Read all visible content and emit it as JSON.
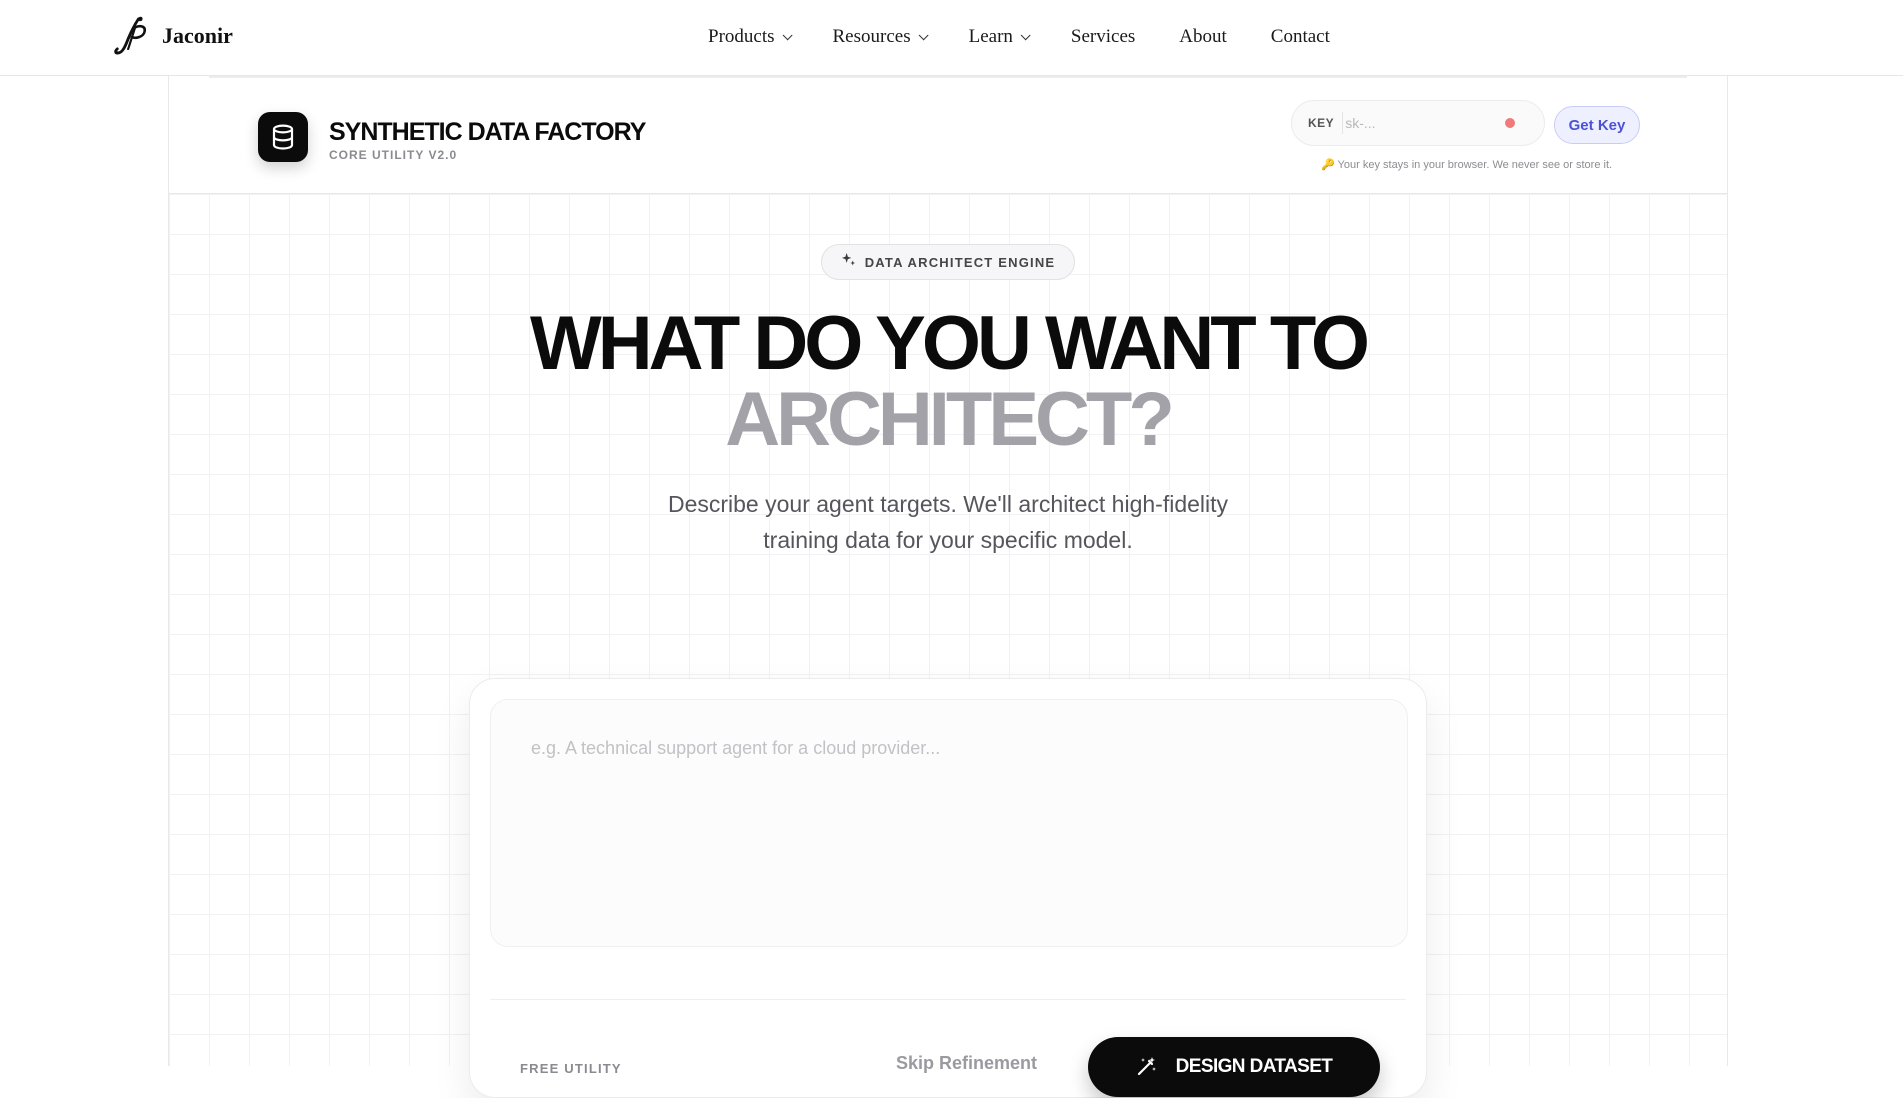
{
  "site": {
    "brand_name": "Jaconir",
    "nav": [
      {
        "label": "Products",
        "dropdown": true
      },
      {
        "label": "Resources",
        "dropdown": true
      },
      {
        "label": "Learn",
        "dropdown": true
      },
      {
        "label": "Services",
        "dropdown": false
      },
      {
        "label": "About",
        "dropdown": false
      },
      {
        "label": "Contact",
        "dropdown": false
      }
    ]
  },
  "app": {
    "icon": "database-icon",
    "title": "SYNTHETIC DATA FACTORY",
    "subtitle": "CORE UTILITY V2.0",
    "key": {
      "label": "KEY",
      "placeholder": "sk-...",
      "value": "",
      "status_color": "#f07a7a",
      "get_key_label": "Get Key",
      "note": "🔑 Your key stays in your browser. We never see or store it."
    }
  },
  "hero": {
    "badge": "DATA ARCHITECT ENGINE",
    "badge_icon": "sparkles-icon",
    "headline_line1": "WHAT DO YOU WANT TO",
    "headline_line2": "ARCHITECT?",
    "subhead_line1": "Describe your agent targets. We'll architect high-fidelity",
    "subhead_line2": "training data for your specific model."
  },
  "prompt": {
    "placeholder": "e.g. A technical support agent for a cloud provider...",
    "value": "",
    "free_label": "FREE UTILITY",
    "skip_label": "Skip Refinement",
    "design_label": "DESIGN DATASET",
    "design_icon": "magic-wand-icon"
  }
}
